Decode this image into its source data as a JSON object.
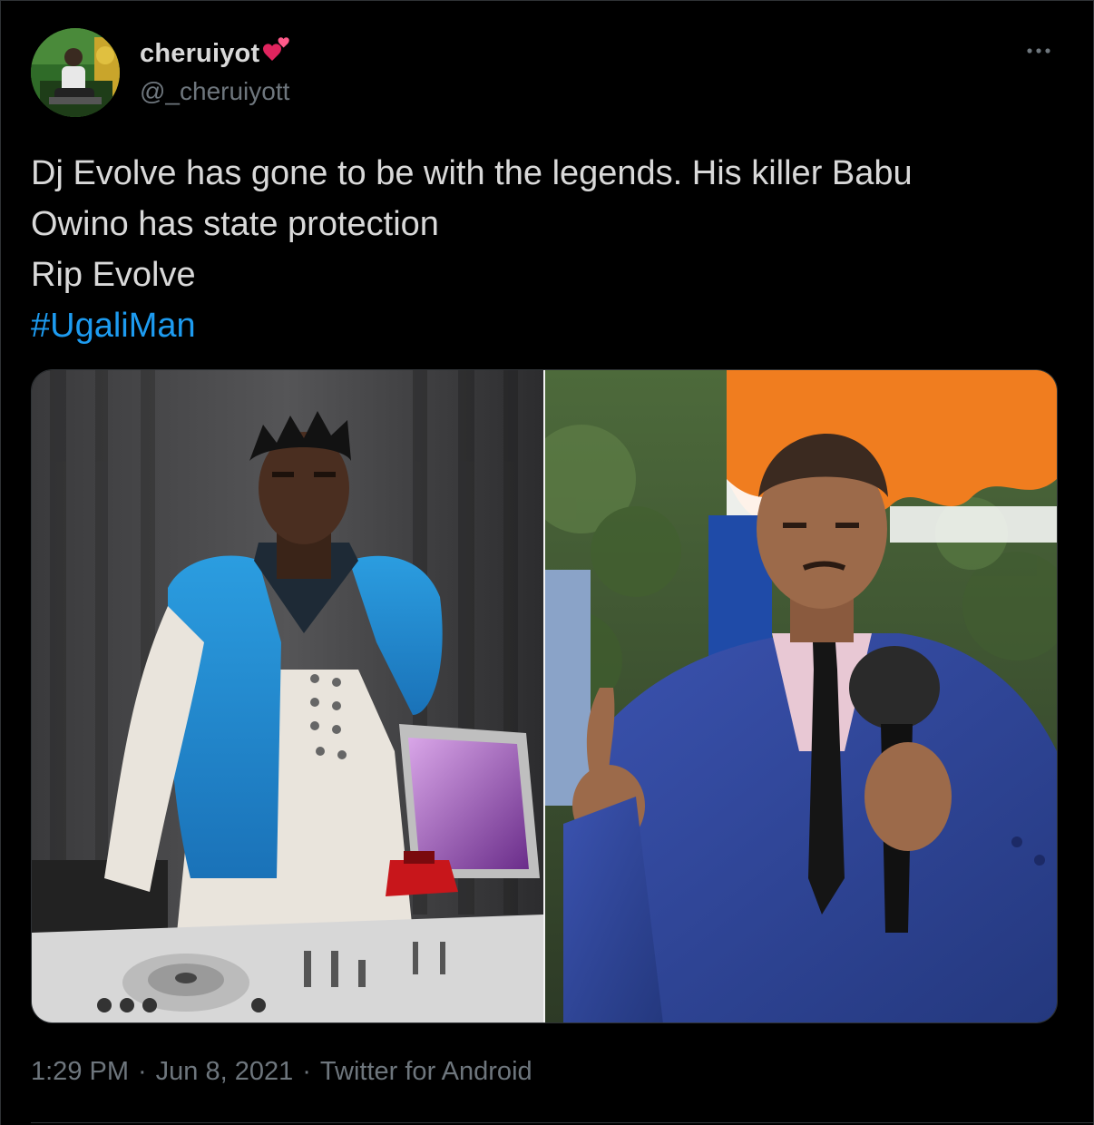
{
  "tweet": {
    "author": {
      "display_name": "cheruiyot",
      "name_emoji": "heart-emoji",
      "handle": "@_cheruiyott",
      "avatar_icon": "avatar"
    },
    "more_icon": "more-dots-icon",
    "text_lines": "Dj Evolve has gone to be with the legends. His killer Babu\nOwino has state protection\nRip Evolve",
    "hashtag": "#UgaliMan",
    "media": {
      "left_photo": "dj-photo",
      "right_photo": "speaker-photo"
    },
    "meta": {
      "time": "1:29 PM",
      "separator": "·",
      "date": "Jun 8, 2021",
      "source": "Twitter for Android"
    }
  },
  "colors": {
    "background": "#000000",
    "text": "#d9d9d9",
    "secondary_text": "#6e767d",
    "link": "#1d9bf0",
    "border": "#2f3336"
  }
}
